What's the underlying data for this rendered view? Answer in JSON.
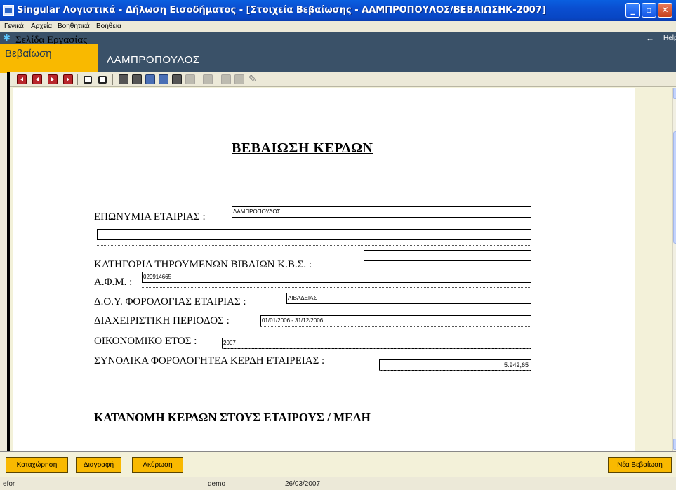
{
  "window": {
    "title": "Singular Λογιστικά - Δήλωση Εισοδήματος - [Στοιχεία Βεβαίωσης - ΑΑΜΠΡΟΠΟΥΛΟΣ/ΒΕΒΑΙΩΣΗΚ-2007]",
    "minimize": "_",
    "maximize": "▫",
    "close": "✕"
  },
  "menu": {
    "items": [
      "Γενικά",
      "Αρχεία",
      "Βοηθητικά",
      "Βοήθεια"
    ]
  },
  "taskbar": {
    "label": "Σελίδα Εργασίας",
    "back_icon": "←",
    "help": "Help"
  },
  "header": {
    "tab": "Βεβαίωση",
    "name": "ΛΑΜΠΡΟΠΟΥΛΟΣ"
  },
  "toolbar": {
    "icons": [
      "first-icon",
      "prev-icon",
      "next-icon",
      "last-icon",
      "frame-left-icon",
      "frame-right-icon",
      "print-icon",
      "print-preview-icon",
      "report-icon",
      "document-icon",
      "export-icon",
      "disabled-icon",
      "disabled-icon",
      "disabled-icon",
      "disabled-icon",
      "edit-pen-icon"
    ]
  },
  "form": {
    "heading": "ΒΕΒΑΙΩΣΗ ΚΕΡΔΩΝ",
    "company_label": "ΕΠΩΝΥΜΙΑ ΕΤΑΙΡΙΑΣ :",
    "company_value": "ΛΑΜΠΡΟΠΟΥΛΟΣ",
    "company_value2": "",
    "books_label": "ΚΑΤΗΓΟΡΙΑ ΤΗΡΟΥΜΕΝΩΝ ΒΙΒΛΙΩΝ Κ.Β.Σ. :",
    "books_value": "",
    "afm_label": "Α.Φ.Μ. :",
    "afm_value": "029914665",
    "doy_label": "Δ.Ο.Υ. ΦΟΡΟΛΟΓΙΑΣ ΕΤΑΙΡΙΑΣ :",
    "doy_value": "ΛΙΒΑΔΕΙΑΣ",
    "period_label": "ΔΙΑΧΕΙΡΙΣΤΙΚΗ ΠΕΡΙΟΔΟΣ :",
    "period_value": "01/01/2006 - 31/12/2006",
    "year_label": "ΟΙΚΟΝΟΜΙΚΟ ΕΤΟΣ :",
    "year_value": "2007",
    "profit_label": "ΣΥΝΟΛΙΚΑ ΦΟΡΟΛΟΓΗΤΕΑ ΚΕΡΔΗ ΕΤΑΙΡΕΙΑΣ :",
    "profit_value": "5.942,65",
    "section2": "ΚΑΤΑΝΟΜΗ ΚΕΡΔΩΝ ΣΤΟΥΣ ΕΤΑΙΡΟΥΣ / ΜΕΛΗ"
  },
  "buttons": {
    "save": "Καταχώρηση",
    "delete": "Διαγραφή",
    "cancel": "Ακύρωση",
    "new": "Νέα Βεβαίωση"
  },
  "status": {
    "app": "efor",
    "user": "demo",
    "date": "26/03/2007"
  },
  "colors": {
    "header_bg": "#3A5168",
    "accent": "#F9B900",
    "paper": "#FFFFFF"
  }
}
